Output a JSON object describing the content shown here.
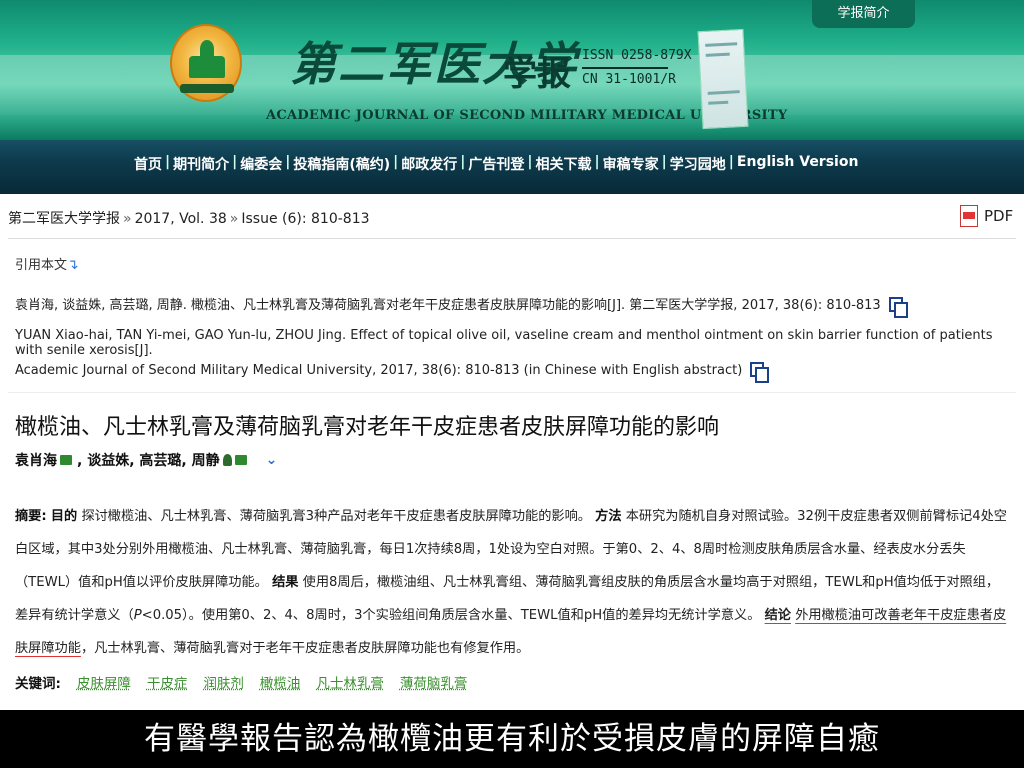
{
  "header": {
    "intro_tab": "学报简介",
    "brand_cn": "第二军医大学",
    "brand_suffix": "学报",
    "issn": "ISSN 0258-879X",
    "cn": "CN 31-1001/R",
    "brand_en": "ACADEMIC JOURNAL OF SECOND MILITARY MEDICAL UNIVERSITY",
    "accent_color": "#1fb08a"
  },
  "nav": {
    "items": [
      "首页",
      "期刊简介",
      "编委会",
      "投稿指南(稿约)",
      "邮政发行",
      "广告刊登",
      "相关下载",
      "审稿专家",
      "学习园地",
      "English Version"
    ],
    "separator": "|"
  },
  "breadcrumb": {
    "journal": "第二军医大学学报",
    "volume": "2017, Vol. 38",
    "issue": "Issue (6): 810-813",
    "sep": "»",
    "pdf_label": "PDF"
  },
  "citation": {
    "label": "引用本文",
    "cn": "袁肖海, 谈益姝, 高芸璐, 周静. 橄榄油、凡士林乳膏及薄荷脑乳膏对老年干皮症患者皮肤屏障功能的影响[J]. 第二军医大学学报, 2017, 38(6): 810-813",
    "en_line1": "YUAN Xiao-hai, TAN Yi-mei, GAO Yun-lu, ZHOU Jing. Effect of topical olive oil, vaseline cream and menthol ointment on skin barrier function of patients with senile xerosis[J].",
    "en_line2": "Academic Journal of Second Military Medical University, 2017, 38(6): 810-813 (in Chinese with English abstract)"
  },
  "article": {
    "title": "橄榄油、凡士林乳膏及薄荷脑乳膏对老年干皮症患者皮肤屏障功能的影响",
    "authors": [
      "袁肖海",
      ", 谈益姝, 高芸璐, 周静"
    ]
  },
  "abstract": {
    "label": "摘要:",
    "objective_label": "目的",
    "objective": "探讨橄榄油、凡士林乳膏、薄荷脑乳膏3种产品对老年干皮症患者皮肤屏障功能的影响。",
    "method_label": "方法",
    "method": "本研究为随机自身对照试验。32例干皮症患者双侧前臂标记4处空白区域，其中3处分别外用橄榄油、凡士林乳膏、薄荷脑乳膏，每日1次持续8周，1处设为空白对照。于第0、2、4、8周时检测皮肤角质层含水量、经表皮水分丢失（TEWL）值和pH值以评价皮肤屏障功能。",
    "result_label": "结果",
    "result_a": "使用8周后，橄榄油组、凡士林乳膏组、薄荷脑乳膏组皮肤的角质层含水量均高于对照组，TEWL和pH值均低于对照组，差异有统计学意义（",
    "p_symbol": "P",
    "result_b": "<0.05）。使用第0、2、4、8周时，3个实验组间角质层含水量、TEWL值和pH值的差异均无统计学意义。",
    "conclusion_label": "结论",
    "conclusion_highlight": "外用橄榄油可改善老年干皮症患者皮肤屏障功能",
    "conclusion_rest": "，凡士林乳膏、薄荷脑乳膏对于老年干皮症患者皮肤屏障功能也有修复作用。"
  },
  "keywords": {
    "label": "关键词:",
    "items": [
      "皮肤屏障",
      "干皮症",
      "润肤剂",
      "橄榄油",
      "凡士林乳膏",
      "薄荷脑乳膏"
    ]
  },
  "subtitle": "有醫學報告認為橄欖油更有利於受損皮膚的屏障自癒"
}
